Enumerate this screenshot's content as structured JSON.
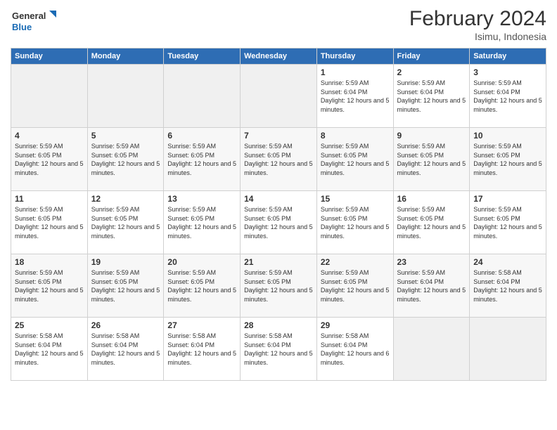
{
  "header": {
    "logo_general": "General",
    "logo_blue": "Blue",
    "month_year": "February 2024",
    "location": "Isimu, Indonesia"
  },
  "weekdays": [
    "Sunday",
    "Monday",
    "Tuesday",
    "Wednesday",
    "Thursday",
    "Friday",
    "Saturday"
  ],
  "weeks": [
    [
      {
        "day": "",
        "empty": true
      },
      {
        "day": "",
        "empty": true
      },
      {
        "day": "",
        "empty": true
      },
      {
        "day": "",
        "empty": true
      },
      {
        "day": "1",
        "sunrise": "Sunrise: 5:59 AM",
        "sunset": "Sunset: 6:04 PM",
        "daylight": "Daylight: 12 hours and 5 minutes."
      },
      {
        "day": "2",
        "sunrise": "Sunrise: 5:59 AM",
        "sunset": "Sunset: 6:04 PM",
        "daylight": "Daylight: 12 hours and 5 minutes."
      },
      {
        "day": "3",
        "sunrise": "Sunrise: 5:59 AM",
        "sunset": "Sunset: 6:04 PM",
        "daylight": "Daylight: 12 hours and 5 minutes."
      }
    ],
    [
      {
        "day": "4",
        "sunrise": "Sunrise: 5:59 AM",
        "sunset": "Sunset: 6:05 PM",
        "daylight": "Daylight: 12 hours and 5 minutes."
      },
      {
        "day": "5",
        "sunrise": "Sunrise: 5:59 AM",
        "sunset": "Sunset: 6:05 PM",
        "daylight": "Daylight: 12 hours and 5 minutes."
      },
      {
        "day": "6",
        "sunrise": "Sunrise: 5:59 AM",
        "sunset": "Sunset: 6:05 PM",
        "daylight": "Daylight: 12 hours and 5 minutes."
      },
      {
        "day": "7",
        "sunrise": "Sunrise: 5:59 AM",
        "sunset": "Sunset: 6:05 PM",
        "daylight": "Daylight: 12 hours and 5 minutes."
      },
      {
        "day": "8",
        "sunrise": "Sunrise: 5:59 AM",
        "sunset": "Sunset: 6:05 PM",
        "daylight": "Daylight: 12 hours and 5 minutes."
      },
      {
        "day": "9",
        "sunrise": "Sunrise: 5:59 AM",
        "sunset": "Sunset: 6:05 PM",
        "daylight": "Daylight: 12 hours and 5 minutes."
      },
      {
        "day": "10",
        "sunrise": "Sunrise: 5:59 AM",
        "sunset": "Sunset: 6:05 PM",
        "daylight": "Daylight: 12 hours and 5 minutes."
      }
    ],
    [
      {
        "day": "11",
        "sunrise": "Sunrise: 5:59 AM",
        "sunset": "Sunset: 6:05 PM",
        "daylight": "Daylight: 12 hours and 5 minutes."
      },
      {
        "day": "12",
        "sunrise": "Sunrise: 5:59 AM",
        "sunset": "Sunset: 6:05 PM",
        "daylight": "Daylight: 12 hours and 5 minutes."
      },
      {
        "day": "13",
        "sunrise": "Sunrise: 5:59 AM",
        "sunset": "Sunset: 6:05 PM",
        "daylight": "Daylight: 12 hours and 5 minutes."
      },
      {
        "day": "14",
        "sunrise": "Sunrise: 5:59 AM",
        "sunset": "Sunset: 6:05 PM",
        "daylight": "Daylight: 12 hours and 5 minutes."
      },
      {
        "day": "15",
        "sunrise": "Sunrise: 5:59 AM",
        "sunset": "Sunset: 6:05 PM",
        "daylight": "Daylight: 12 hours and 5 minutes."
      },
      {
        "day": "16",
        "sunrise": "Sunrise: 5:59 AM",
        "sunset": "Sunset: 6:05 PM",
        "daylight": "Daylight: 12 hours and 5 minutes."
      },
      {
        "day": "17",
        "sunrise": "Sunrise: 5:59 AM",
        "sunset": "Sunset: 6:05 PM",
        "daylight": "Daylight: 12 hours and 5 minutes."
      }
    ],
    [
      {
        "day": "18",
        "sunrise": "Sunrise: 5:59 AM",
        "sunset": "Sunset: 6:05 PM",
        "daylight": "Daylight: 12 hours and 5 minutes."
      },
      {
        "day": "19",
        "sunrise": "Sunrise: 5:59 AM",
        "sunset": "Sunset: 6:05 PM",
        "daylight": "Daylight: 12 hours and 5 minutes."
      },
      {
        "day": "20",
        "sunrise": "Sunrise: 5:59 AM",
        "sunset": "Sunset: 6:05 PM",
        "daylight": "Daylight: 12 hours and 5 minutes."
      },
      {
        "day": "21",
        "sunrise": "Sunrise: 5:59 AM",
        "sunset": "Sunset: 6:05 PM",
        "daylight": "Daylight: 12 hours and 5 minutes."
      },
      {
        "day": "22",
        "sunrise": "Sunrise: 5:59 AM",
        "sunset": "Sunset: 6:05 PM",
        "daylight": "Daylight: 12 hours and 5 minutes."
      },
      {
        "day": "23",
        "sunrise": "Sunrise: 5:59 AM",
        "sunset": "Sunset: 6:04 PM",
        "daylight": "Daylight: 12 hours and 5 minutes."
      },
      {
        "day": "24",
        "sunrise": "Sunrise: 5:58 AM",
        "sunset": "Sunset: 6:04 PM",
        "daylight": "Daylight: 12 hours and 5 minutes."
      }
    ],
    [
      {
        "day": "25",
        "sunrise": "Sunrise: 5:58 AM",
        "sunset": "Sunset: 6:04 PM",
        "daylight": "Daylight: 12 hours and 5 minutes."
      },
      {
        "day": "26",
        "sunrise": "Sunrise: 5:58 AM",
        "sunset": "Sunset: 6:04 PM",
        "daylight": "Daylight: 12 hours and 5 minutes."
      },
      {
        "day": "27",
        "sunrise": "Sunrise: 5:58 AM",
        "sunset": "Sunset: 6:04 PM",
        "daylight": "Daylight: 12 hours and 5 minutes."
      },
      {
        "day": "28",
        "sunrise": "Sunrise: 5:58 AM",
        "sunset": "Sunset: 6:04 PM",
        "daylight": "Daylight: 12 hours and 5 minutes."
      },
      {
        "day": "29",
        "sunrise": "Sunrise: 5:58 AM",
        "sunset": "Sunset: 6:04 PM",
        "daylight": "Daylight: 12 hours and 6 minutes."
      },
      {
        "day": "",
        "empty": true
      },
      {
        "day": "",
        "empty": true
      }
    ]
  ]
}
